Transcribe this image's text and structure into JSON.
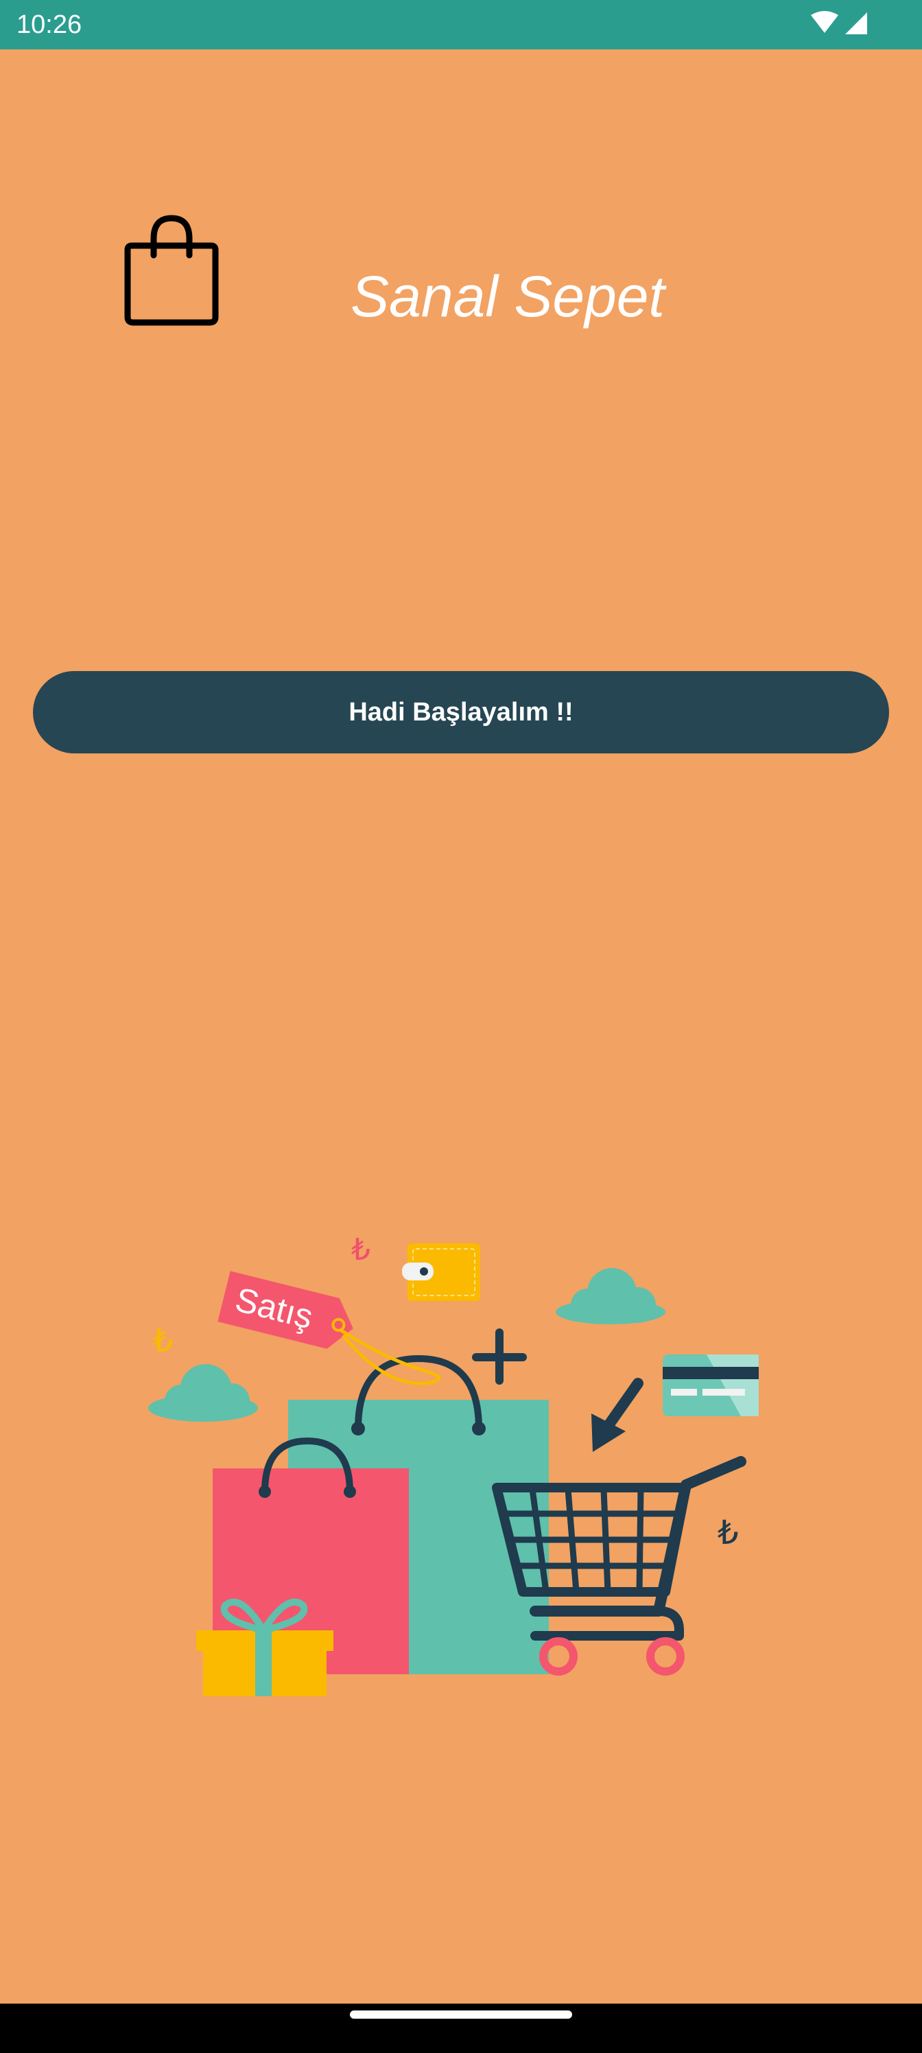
{
  "status_bar": {
    "time": "10:26",
    "icons": [
      "wifi-icon",
      "cellular-signal-icon"
    ],
    "background_color": "#2A9D8F"
  },
  "app": {
    "logo_icon": "shopping-bag-icon",
    "title": "Sanal Sepet",
    "background_color": "#F2A262"
  },
  "start_button": {
    "label": "Hadi Başlayalım !!",
    "color": "#264653"
  },
  "illustration": {
    "sale_tag_text": "Satış",
    "currency_symbol": "₺"
  }
}
